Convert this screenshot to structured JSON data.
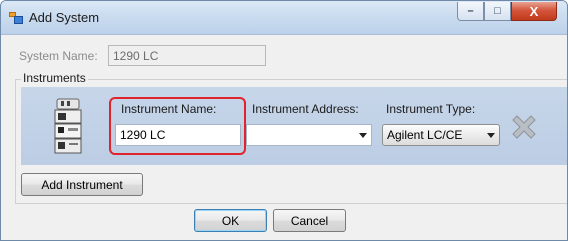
{
  "window": {
    "title": "Add System",
    "icon": "app-window-icon"
  },
  "caption_buttons": {
    "minimize": "–",
    "maximize": "□",
    "close": "X"
  },
  "system": {
    "label": "System Name:",
    "value": "1290 LC"
  },
  "instruments": {
    "group_label": "Instruments",
    "row": {
      "icon": "lc-instrument-icon",
      "name_label": "Instrument Name:",
      "name_value": "1290 LC",
      "address_label": "Instrument Address:",
      "address_value": "",
      "type_label": "Instrument Type:",
      "type_value": "Agilent LC/CE",
      "remove_icon": "remove-x-icon"
    }
  },
  "buttons": {
    "add_instrument": "Add Instrument",
    "ok": "OK",
    "cancel": "Cancel"
  },
  "colors": {
    "instrument_row": "#c3d3e8",
    "highlight": "#e0242c"
  }
}
